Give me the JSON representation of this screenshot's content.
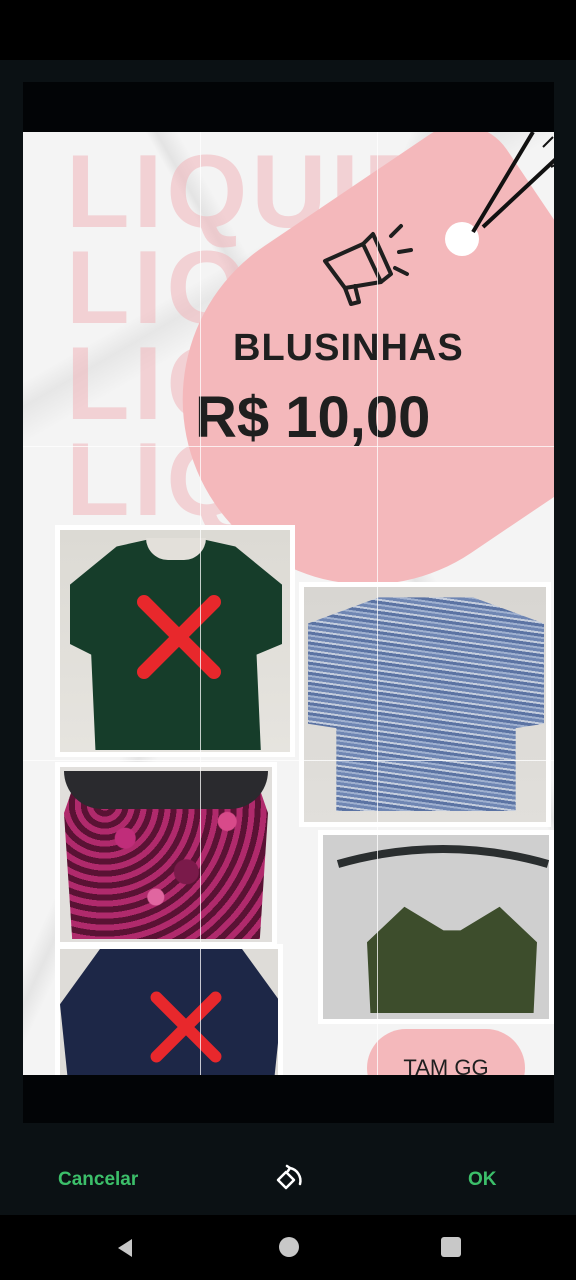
{
  "poster": {
    "background_word": "LIQUIDA",
    "title": "BLUSINHAS",
    "price": "R$ 10,00",
    "size_label": "TAM GG"
  },
  "editor": {
    "cancel_label": "Cancelar",
    "ok_label": "OK"
  },
  "colors": {
    "accent_green": "#3cbf6a",
    "tag_pink": "#f4b8bb",
    "x_mark_red": "#e8282c"
  },
  "icons": {
    "rotate": "rotate-icon",
    "megaphone": "megaphone-icon",
    "nav_back": "back-triangle-icon",
    "nav_home": "home-circle-icon",
    "nav_recent": "recent-square-icon"
  }
}
